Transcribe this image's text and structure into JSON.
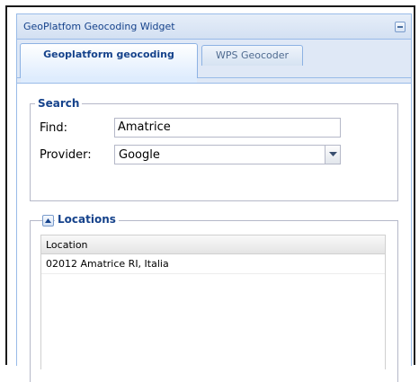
{
  "panel": {
    "title": "GeoPlatfom Geocoding Widget",
    "tabs": [
      {
        "label": "Geoplatform geocoding",
        "active": true
      },
      {
        "label": "WPS Geocoder",
        "active": false
      }
    ]
  },
  "search": {
    "legend": "Search",
    "find_label": "Find:",
    "find_value": "Amatrice",
    "provider_label": "Provider:",
    "provider_value": "Google"
  },
  "locations": {
    "legend": "Locations",
    "column_header": "Location",
    "rows": [
      "02012 Amatrice RI, Italia"
    ]
  },
  "colors": {
    "accent": "#15428b",
    "panel_border": "#99bbe8",
    "header_bg": "#dfe8f6"
  },
  "icons": [
    "collapse-icon",
    "chevron-down-icon",
    "chevron-up-icon"
  ]
}
